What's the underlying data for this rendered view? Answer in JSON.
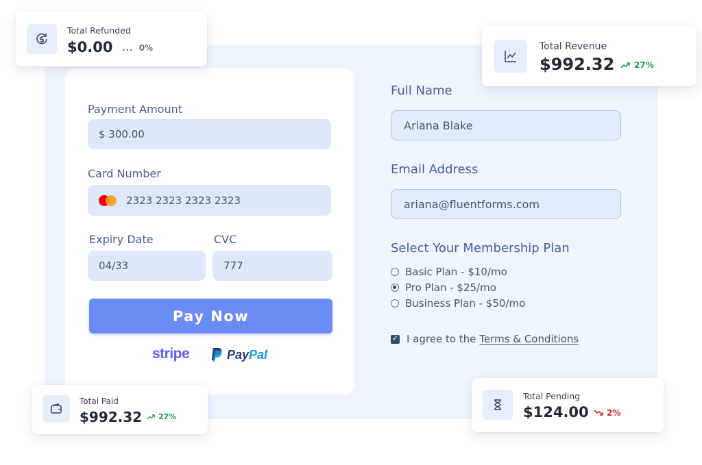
{
  "payment_form": {
    "amount_label": "Payment Amount",
    "amount_value": "$ 300.00",
    "card_label": "Card Number",
    "card_value": "2323 2323 2323 2323",
    "expiry_label": "Expiry Date",
    "expiry_value": "04/33",
    "cvc_label": "CVC",
    "cvc_value": "777",
    "pay_button": "Pay Now",
    "stripe_text": "stripe",
    "paypal_pay": "Pay",
    "paypal_pal": "Pal"
  },
  "details_form": {
    "name_label": "Full Name",
    "name_value": "Ariana Blake",
    "email_label": "Email Address",
    "email_value": "ariana@fluentforms.com",
    "plan_label": "Select Your Membership Plan",
    "plans": [
      {
        "label": "Basic Plan - $10/mo",
        "selected": false
      },
      {
        "label": "Pro Plan - $25/mo",
        "selected": true
      },
      {
        "label": "Business Plan - $50/mo",
        "selected": false
      }
    ],
    "agree_text": "I agree to the",
    "terms_text": "Terms & Conditions",
    "agree_checked": true
  },
  "stats": {
    "refunded": {
      "label": "Total Refunded",
      "value": "$0.00",
      "trend": "0%",
      "trend_dir": "neutral",
      "icon": "refund-dollar-icon"
    },
    "revenue": {
      "label": "Total Revenue",
      "value": "$992.32",
      "trend": "27%",
      "trend_dir": "up",
      "icon": "line-chart-icon"
    },
    "paid": {
      "label": "Total Paid",
      "value": "$992.32",
      "trend": "27%",
      "trend_dir": "up",
      "icon": "wallet-icon"
    },
    "pending": {
      "label": "Total Pending",
      "value": "$124.00",
      "trend": "2%",
      "trend_dir": "down",
      "icon": "hourglass-icon"
    }
  },
  "colors": {
    "button": "#6b8cf5",
    "panel_bg": "#eef5fe",
    "input_bg": "#dde9fa",
    "trend_up": "#16a34a",
    "trend_down": "#dc2626"
  }
}
